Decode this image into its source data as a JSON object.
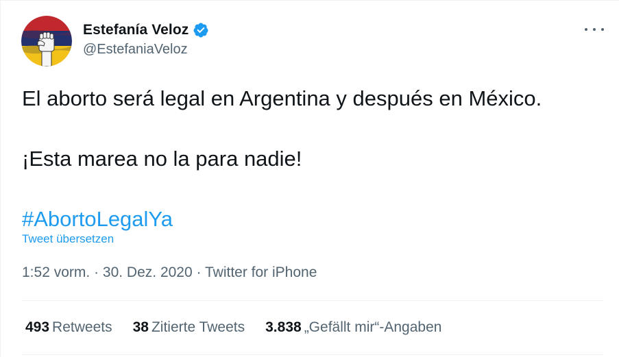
{
  "author": {
    "display_name": "Estefanía Veloz",
    "handle": "@EstefaniaVeloz",
    "verified": true
  },
  "tweet": {
    "lines": [
      "El aborto será legal en Argentina y después en México.",
      "¡Esta marea no la para nadie!"
    ],
    "hashtag": "#AbortoLegalYa",
    "translate_label": "Tweet übersetzen"
  },
  "meta": {
    "time": "1:52 vorm.",
    "separator": "·",
    "date": "30. Dez. 2020",
    "source": "Twitter for iPhone"
  },
  "stats": {
    "retweets": {
      "count": "493",
      "label": "Retweets"
    },
    "quotes": {
      "count": "38",
      "label": "Zitierte Tweets"
    },
    "likes": {
      "count": "3.838",
      "label": "„Gefällt mir“-Angaben"
    }
  },
  "icons": {
    "verified": "verified-badge-icon",
    "more": "more-options-icon",
    "avatar": "raised-fist-flag-avatar"
  },
  "colors": {
    "accent": "#1d9bf0",
    "text": "#0f1419",
    "secondary": "#536471",
    "divider": "#eff3f4"
  }
}
